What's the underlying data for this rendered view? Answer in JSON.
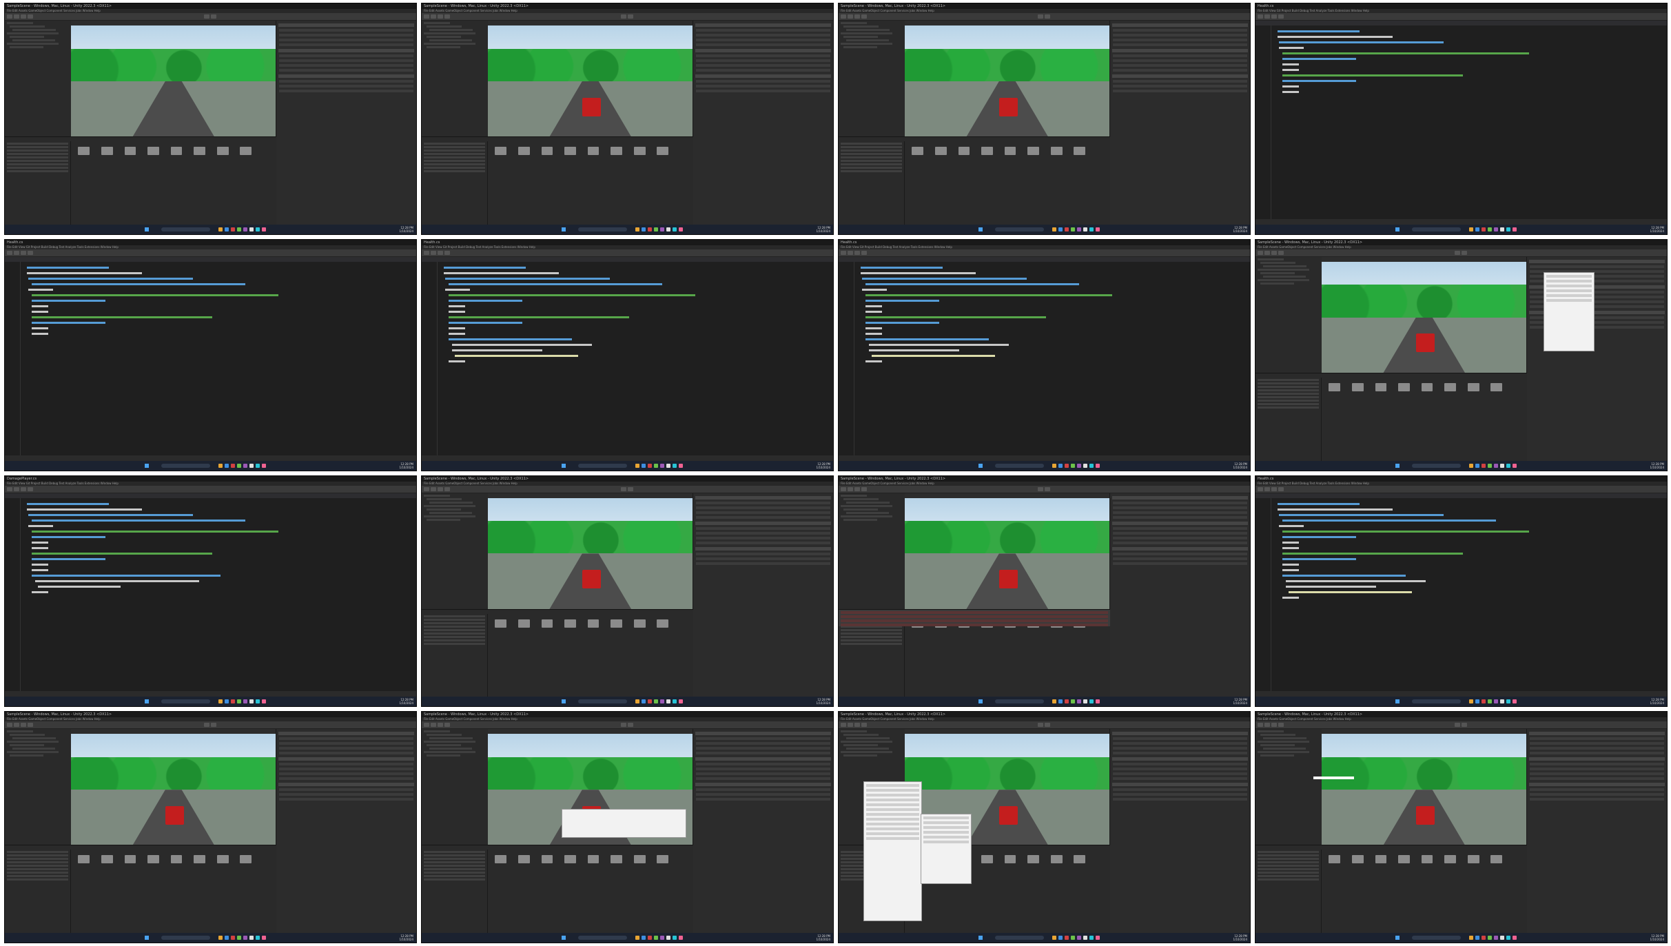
{
  "sheet": {
    "frames": [
      {
        "kind": "editor",
        "title": "SampleScene - Windows, Mac, Linux - Unity 2022.3 <DX11>",
        "variant": "track-overview"
      },
      {
        "kind": "editor",
        "title": "SampleScene - Windows, Mac, Linux - Unity 2022.3 <DX11>",
        "variant": "arch-ball"
      },
      {
        "kind": "editor",
        "title": "SampleScene - Windows, Mac, Linux - Unity 2022.3 <DX11>",
        "variant": "car"
      },
      {
        "kind": "code",
        "title": "Health.cs",
        "variant": "template"
      },
      {
        "kind": "code",
        "title": "Health.cs",
        "variant": "fields"
      },
      {
        "kind": "code",
        "title": "Health.cs",
        "variant": "take-damage"
      },
      {
        "kind": "code",
        "title": "Health.cs",
        "variant": "take-damage-full"
      },
      {
        "kind": "editor",
        "title": "SampleScene - Windows, Mac, Linux - Unity 2022.3 <DX11>",
        "variant": "car-dropdown"
      },
      {
        "kind": "code",
        "title": "DamagePlayer.cs",
        "variant": "collision"
      },
      {
        "kind": "editor",
        "title": "SampleScene - Windows, Mac, Linux - Unity 2022.3 <DX11>",
        "variant": "car"
      },
      {
        "kind": "editor",
        "title": "SampleScene - Windows, Mac, Linux - Unity 2022.3 <DX11>",
        "variant": "console-errors"
      },
      {
        "kind": "code",
        "title": "Health.cs",
        "variant": "take-damage-full"
      },
      {
        "kind": "editor",
        "title": "SampleScene - Windows, Mac, Linux - Unity 2022.3 <DX11>",
        "variant": "car"
      },
      {
        "kind": "editor",
        "title": "SampleScene - Windows, Mac, Linux - Unity 2022.3 <DX11>",
        "variant": "dialog"
      },
      {
        "kind": "editor",
        "title": "SampleScene - Windows, Mac, Linux - Unity 2022.3 <DX11>",
        "variant": "context-menu"
      },
      {
        "kind": "editor",
        "title": "SampleScene - Windows, Mac, Linux - Unity 2022.3 <DX11>",
        "variant": "healthbar"
      }
    ],
    "menus": {
      "unity": "File  Edit  Assets  GameObject  Component  Services  Jobs  Window  Help",
      "vs": "File  Edit  View  Git  Project  Build  Debug  Test  Analyze  Tools  Extensions  Window  Help"
    },
    "taskbar": {
      "search": "Search",
      "time": "12:28 PM",
      "date": "1/10/2024"
    },
    "colors": {
      "editor_bg": "#1e1e1e",
      "panel": "#2a2a2a",
      "toolbar": "#3a3a3a",
      "taskbar": "#1b2230",
      "tree_green": "#2ab042",
      "road": "#4c4c4c",
      "car_red": "#c41e1e"
    }
  }
}
